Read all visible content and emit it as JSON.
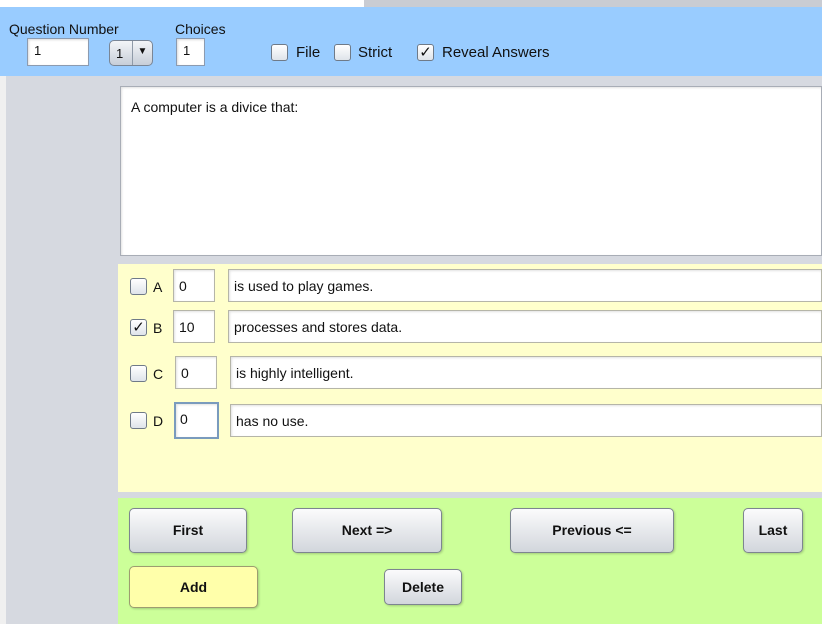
{
  "header": {
    "question_number_label": "Question Number",
    "question_number_value": "1",
    "combo_value": "1",
    "combo_arrow": "▼",
    "choices_label": "Choices",
    "choices_value": "1",
    "file_label": "File",
    "strict_label": "Strict",
    "reveal_label": "Reveal Answers",
    "reveal_checked_mark": "✓"
  },
  "question": {
    "text": "A computer is a divice that:"
  },
  "answers": [
    {
      "letter": "A",
      "points": "0",
      "text": "is used to play games.",
      "mark": ""
    },
    {
      "letter": "B",
      "points": "10",
      "text": "processes and stores data.",
      "mark": "✓"
    },
    {
      "letter": "C",
      "points": "0",
      "text": "is highly intelligent.",
      "mark": ""
    },
    {
      "letter": "D",
      "points": "0",
      "text": "has no use.",
      "mark": ""
    }
  ],
  "buttons": {
    "first": "First",
    "next": "Next =>",
    "previous": "Previous <=",
    "last": "Last",
    "add": "Add",
    "delete": "Delete"
  },
  "colors": {
    "header_bg": "#99ccff",
    "answers_bg": "#ffffcc",
    "buttons_bg": "#ccff99",
    "add_button_bg": "#ffffaa"
  }
}
